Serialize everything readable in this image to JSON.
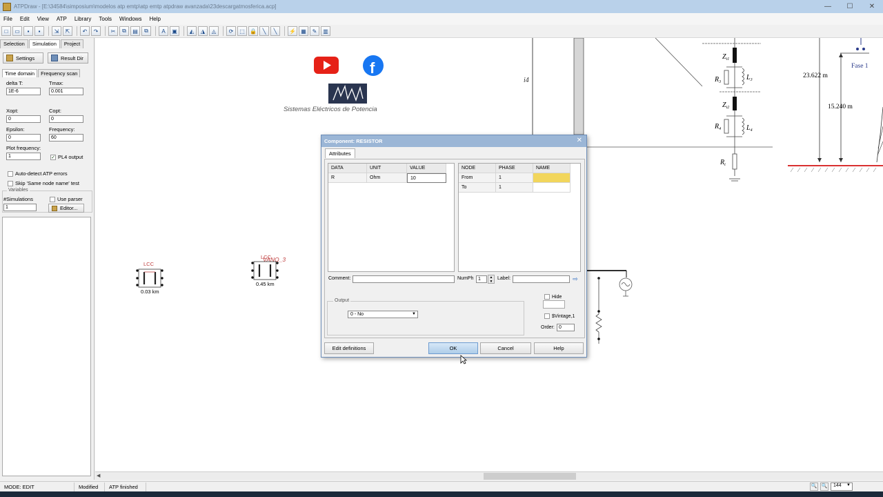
{
  "window": {
    "title": "ATPDraw - [E:\\34584\\simposium\\modelos atp emtp\\atp emtp atpdraw avanzada\\23descargatmosferica.acp]"
  },
  "menu": [
    "File",
    "Edit",
    "View",
    "ATP",
    "Library",
    "Tools",
    "Windows",
    "Help"
  ],
  "left_panel": {
    "tabs": [
      "Selection",
      "Simulation",
      "Project"
    ],
    "settings_button": "Settings",
    "result_dir_button": "Result Dir",
    "subtabs": [
      "Time domain",
      "Frequency scan"
    ],
    "delta_t_label": "delta T:",
    "delta_t": "1E-6",
    "tmax_label": "Tmax:",
    "tmax": "0.001",
    "xopt_label": "Xopt:",
    "xopt": "0",
    "copt_label": "Copt:",
    "copt": "0",
    "epsilon_label": "Epsilon:",
    "epsilon": "0",
    "frequency_label": "Frequency:",
    "frequency": "60",
    "plot_freq_label": "Plot frequency:",
    "plot_freq": "1",
    "pl4_output": "PL4 output",
    "auto_detect": "Auto-detect ATP errors",
    "skip_same_node": "Skip 'Same node name' test",
    "variables_legend": "Variables",
    "simulations_label": "#Simulations",
    "simulations": "1",
    "use_parser": "Use parser",
    "editor_button": "Editor..."
  },
  "canvas": {
    "logo_caption": "Sistemas Eléctricos de Potencia",
    "lcc1_label": "LCC",
    "lcc1_length": "0.03 km",
    "lcc2_label": "LCC",
    "lcc2_name": "VANO_3",
    "lcc2_length": "0.45 km",
    "i4": "i4",
    "z11": "Z",
    "z11_sub": "t1",
    "r3": "R",
    "r3_sub": "3",
    "l3": "L",
    "l3_sub": "3",
    "zt2": "Z",
    "zt2_sub": "t2",
    "r4": "R",
    "r4_sub": "4",
    "l4": "L",
    "l4_sub": "4",
    "rt": "R",
    "rt_sub": "t",
    "dim1": "23.622 m",
    "dim2": "15.240 m",
    "fase": "Fase 1"
  },
  "dialog": {
    "title": "Component: RESISTOR",
    "tab": "Attributes",
    "attr_headers": [
      "DATA",
      "UNIT",
      "VALUE"
    ],
    "attr_rows": [
      {
        "data": "R",
        "unit": "Ohm",
        "value": "10"
      }
    ],
    "node_headers": [
      "NODE",
      "PHASE",
      "NAME"
    ],
    "node_rows": [
      {
        "node": "From",
        "phase": "1",
        "name": ""
      },
      {
        "node": "To",
        "phase": "1",
        "name": ""
      }
    ],
    "comment_label": "Comment:",
    "comment": "",
    "numph_label": "NumPh",
    "numph": "1",
    "label_label": "Label:",
    "label": "",
    "output_legend": "Output",
    "output_value": "0 - No",
    "hide": "Hide",
    "vintage": "$Vintage,1",
    "order_label": "Order:",
    "order": "0",
    "edit_definitions": "Edit definitions",
    "ok": "OK",
    "cancel": "Cancel",
    "help": "Help"
  },
  "status": {
    "mode": "MODE: EDIT",
    "modified": "Modified",
    "atp": "ATP finished",
    "zoom": "144"
  },
  "colors": {
    "accent": "#9bb6d6",
    "youtube": "#e62117",
    "facebook": "#1877f2",
    "highlight": "#f2d65c",
    "ground": "#d93030"
  }
}
